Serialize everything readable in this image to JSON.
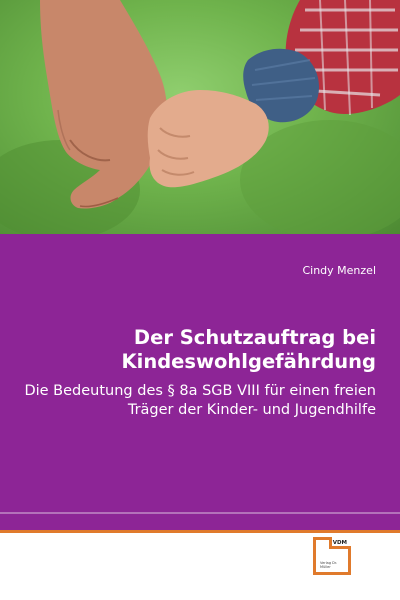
{
  "book": {
    "author": "Cindy Menzel",
    "title": "Der Schutzauftrag bei Kindeswohlgefährdung",
    "subtitle": "Die Bedeutung des § 8a SGB VIII für einen freien Träger der Kinder- und Jugendhilfe"
  },
  "publisher_logo": {
    "mark": "VDM",
    "sub": "Verlag Dr. Müller"
  },
  "colors": {
    "panel": "#8d2596",
    "accent": "#e07a2c",
    "background": "#ffffff"
  },
  "photo": {
    "subject": "adult-hand-holding-child-hand-icon"
  }
}
